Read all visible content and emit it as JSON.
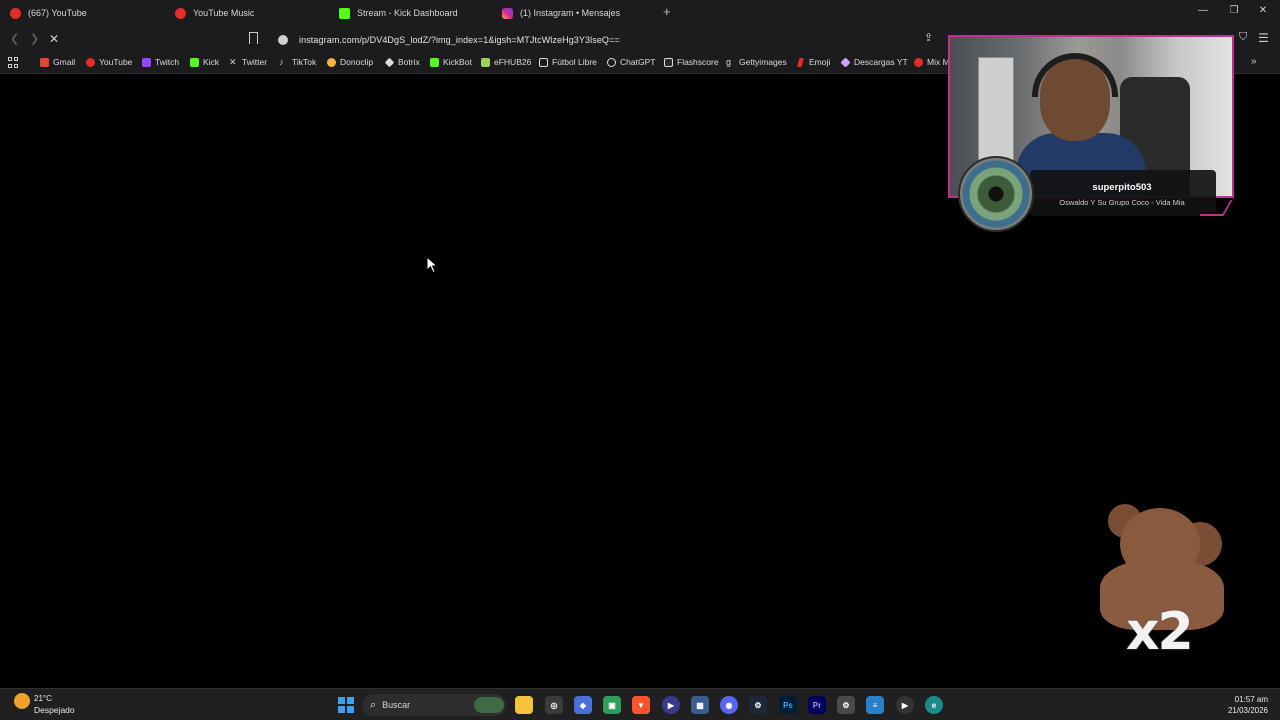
{
  "browser": {
    "tabs": [
      {
        "label": "(667) YouTube",
        "icon": "youtube-icon",
        "color": "#e52d27"
      },
      {
        "label": "YouTube Music",
        "icon": "youtube-music-icon",
        "color": "#e52d27"
      },
      {
        "label": "Stream - Kick Dashboard",
        "icon": "kick-icon",
        "color": "#53fc18"
      },
      {
        "label": "(1) Instagram • Mensajes",
        "icon": "instagram-icon",
        "color": "#d6249f"
      }
    ],
    "url": "instagram.com/p/DV4DgS_lodZ/?img_index=1&igsh=MTJtcWlzeHg3Y3lseQ==",
    "bookmarks": [
      {
        "label": "Gmail",
        "icon": "gmail-icon",
        "color": "#ea4335"
      },
      {
        "label": "YouTube",
        "icon": "youtube-icon",
        "color": "#e52d27"
      },
      {
        "label": "Twitch",
        "icon": "twitch-icon",
        "color": "#9146ff"
      },
      {
        "label": "Kick",
        "icon": "kick-icon",
        "color": "#53fc18"
      },
      {
        "label": "Twitter",
        "icon": "x-icon",
        "color": "#cfcfcf"
      },
      {
        "label": "TikTok",
        "icon": "tiktok-icon",
        "color": "#cfcfcf"
      },
      {
        "label": "Donoclip",
        "icon": "donoclip-icon",
        "color": "#f1b53c"
      },
      {
        "label": "Botrix",
        "icon": "botrix-icon",
        "color": "#dcdcdc"
      },
      {
        "label": "KickBot",
        "icon": "kickbot-icon",
        "color": "#53fc18"
      },
      {
        "label": "eFHUB26",
        "icon": "efhub-icon",
        "color": "#9bd25b"
      },
      {
        "label": "Fútbol Libre",
        "icon": "futbol-icon",
        "color": "#dcdcdc"
      },
      {
        "label": "ChatGPT",
        "icon": "chatgpt-icon",
        "color": "#dcdcdc"
      },
      {
        "label": "Flashscore",
        "icon": "flashscore-icon",
        "color": "#dcdcdc"
      },
      {
        "label": "Gettyimages",
        "icon": "gettyimages-icon",
        "color": "#dcdcdc"
      },
      {
        "label": "Emoji",
        "icon": "emoji-icon",
        "color": "#e52d27"
      },
      {
        "label": "Descargas YT",
        "icon": "descargas-icon",
        "color": "#c9a3f5"
      },
      {
        "label": "Mix M",
        "icon": "youtube-icon",
        "color": "#e52d27"
      }
    ]
  },
  "overlay": {
    "username": "superpito503",
    "song": "Oswaldo Y Su Grupo Coco - Vida Mia",
    "multiplier": "x2",
    "accent": "#c2308f"
  },
  "taskbar": {
    "weather_temp": "21°C",
    "weather_condition": "Despejado",
    "search_placeholder": "Buscar",
    "time": "01:57 am",
    "date": "21/03/2026",
    "apps": [
      {
        "icon": "file-explorer-icon",
        "color": "#f5c33b",
        "glyph": ""
      },
      {
        "icon": "chrome-icon",
        "color": "#3b3b3b",
        "glyph": "◎"
      },
      {
        "icon": "obsidian-icon",
        "color": "#4a6fd8",
        "glyph": "◆"
      },
      {
        "icon": "app-green-icon",
        "color": "#2e9e5a",
        "glyph": "▣"
      },
      {
        "icon": "brave-icon",
        "color": "#fb542b",
        "glyph": "▼"
      },
      {
        "icon": "media-player-icon",
        "color": "#3a3a8a",
        "glyph": "▶"
      },
      {
        "icon": "calculator-icon",
        "color": "#3a5d8f",
        "glyph": "▦"
      },
      {
        "icon": "discord-icon",
        "color": "#5865f2",
        "glyph": "◉"
      },
      {
        "icon": "steam-icon",
        "color": "#1b2838",
        "glyph": "⚙"
      },
      {
        "icon": "photoshop-icon",
        "color": "#001e36",
        "glyph": "Ps"
      },
      {
        "icon": "premiere-icon",
        "color": "#00005b",
        "glyph": "Pr"
      },
      {
        "icon": "settings-icon",
        "color": "#4a4a4a",
        "glyph": "⚙"
      },
      {
        "icon": "notepad-icon",
        "color": "#2a7fc9",
        "glyph": "≡"
      },
      {
        "icon": "play-icon",
        "color": "#333333",
        "glyph": "▶"
      },
      {
        "icon": "edge-icon",
        "color": "#1a8a8a",
        "glyph": "e"
      }
    ]
  }
}
